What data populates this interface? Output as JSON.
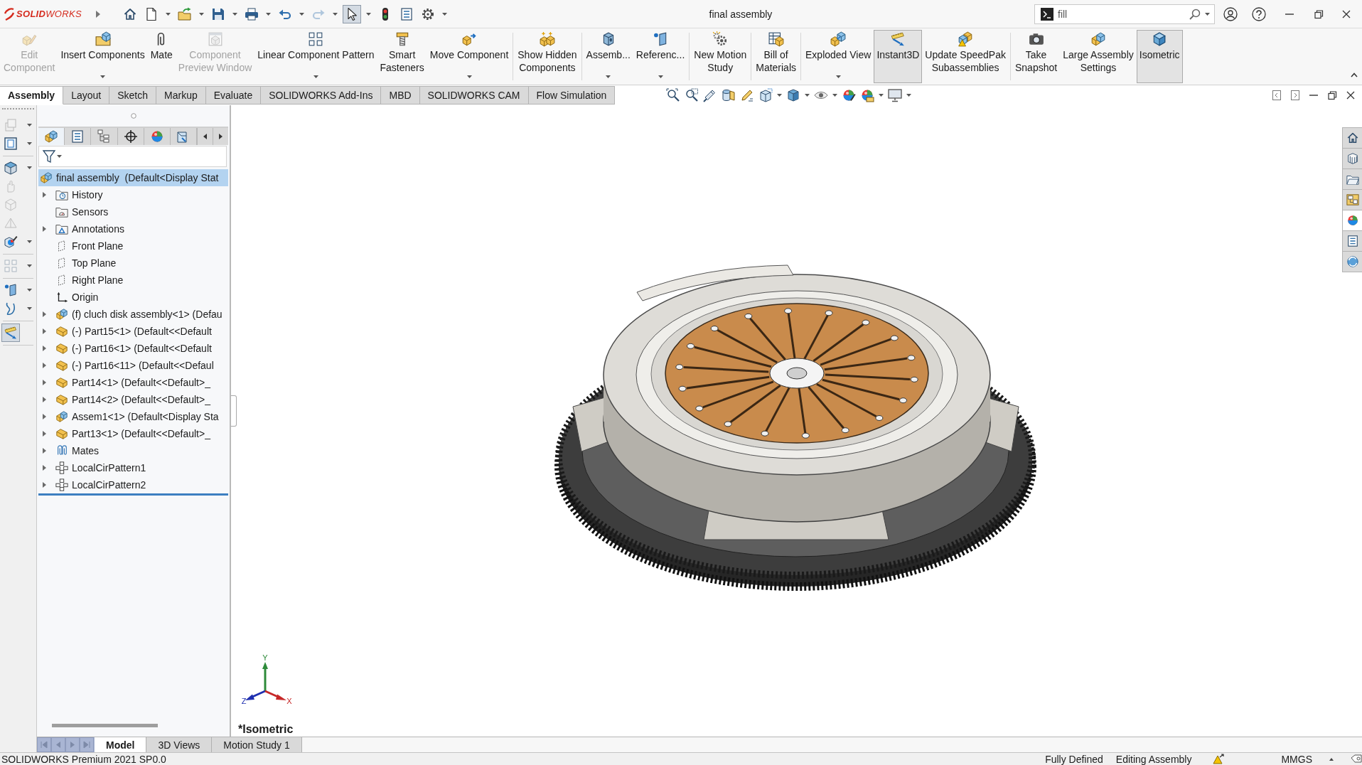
{
  "title_bar": {
    "logo": "**SOLID**WORKS",
    "quick_access": [
      {
        "kind": "home",
        "dropdown": false,
        "disabled": false,
        "pressed": false
      },
      {
        "kind": "new",
        "dropdown": true,
        "disabled": false,
        "pressed": false
      },
      {
        "kind": "open",
        "dropdown": true,
        "disabled": false,
        "pressed": false
      },
      {
        "kind": "save",
        "dropdown": true,
        "disabled": false,
        "pressed": false
      },
      {
        "kind": "print",
        "dropdown": true,
        "disabled": false,
        "pressed": false
      },
      {
        "kind": "undo",
        "dropdown": true,
        "disabled": false,
        "pressed": false
      },
      {
        "kind": "redo",
        "dropdown": true,
        "disabled": true,
        "pressed": false
      },
      {
        "kind": "select",
        "dropdown": true,
        "disabled": false,
        "pressed": true
      },
      {
        "kind": "rebuild",
        "dropdown": false,
        "disabled": false,
        "pressed": false
      },
      {
        "kind": "properties",
        "dropdown": false,
        "disabled": false,
        "pressed": false
      },
      {
        "kind": "options",
        "dropdown": true,
        "disabled": false,
        "pressed": false
      }
    ],
    "title": "final assembly",
    "search": {
      "value": "fill"
    }
  },
  "ribbon": {
    "groups": [
      [
        {
          "kind": "edit-component",
          "lines": [
            "Edit",
            "Component"
          ],
          "disabled": true,
          "dropdown": false,
          "pressed": false
        },
        {
          "kind": "insert-components",
          "lines": [
            "Insert Components"
          ],
          "disabled": false,
          "dropdown": true,
          "pressed": false
        },
        {
          "kind": "mate",
          "lines": [
            "Mate"
          ],
          "disabled": false,
          "dropdown": false,
          "pressed": false
        },
        {
          "kind": "preview-window",
          "lines": [
            "Component",
            "Preview Window"
          ],
          "disabled": true,
          "dropdown": false,
          "pressed": false
        },
        {
          "kind": "linear-pattern",
          "lines": [
            "Linear Component Pattern"
          ],
          "disabled": false,
          "dropdown": true,
          "pressed": false
        },
        {
          "kind": "smart-fasteners",
          "lines": [
            "Smart",
            "Fasteners"
          ],
          "disabled": false,
          "dropdown": false,
          "pressed": false
        },
        {
          "kind": "move-component",
          "lines": [
            "Move Component"
          ],
          "disabled": false,
          "dropdown": true,
          "pressed": false
        }
      ],
      [
        {
          "kind": "show-hidden",
          "lines": [
            "Show Hidden",
            "Components"
          ],
          "disabled": false,
          "dropdown": false,
          "pressed": false
        }
      ],
      [
        {
          "kind": "assembly-features",
          "lines": [
            "Assemb..."
          ],
          "disabled": false,
          "dropdown": true,
          "pressed": false
        },
        {
          "kind": "reference-geometry",
          "lines": [
            "Referenc..."
          ],
          "disabled": false,
          "dropdown": true,
          "pressed": false
        }
      ],
      [
        {
          "kind": "motion-study",
          "lines": [
            "New Motion",
            "Study"
          ],
          "disabled": false,
          "dropdown": false,
          "pressed": false
        }
      ],
      [
        {
          "kind": "bom",
          "lines": [
            "Bill of",
            "Materials"
          ],
          "disabled": false,
          "dropdown": false,
          "pressed": false
        }
      ],
      [
        {
          "kind": "exploded-view",
          "lines": [
            "Exploded View"
          ],
          "disabled": false,
          "dropdown": true,
          "pressed": false
        },
        {
          "kind": "instant3d",
          "lines": [
            "Instant3D"
          ],
          "disabled": false,
          "dropdown": false,
          "pressed": true
        },
        {
          "kind": "speedpak",
          "lines": [
            "Update SpeedPak",
            "Subassemblies"
          ],
          "disabled": false,
          "dropdown": false,
          "pressed": false
        }
      ],
      [
        {
          "kind": "snapshot",
          "lines": [
            "Take",
            "Snapshot"
          ],
          "disabled": false,
          "dropdown": false,
          "pressed": false
        },
        {
          "kind": "large-assembly",
          "lines": [
            "Large Assembly",
            "Settings"
          ],
          "disabled": false,
          "dropdown": false,
          "pressed": false
        },
        {
          "kind": "isometric",
          "lines": [
            "Isometric"
          ],
          "disabled": false,
          "dropdown": false,
          "pressed": true
        }
      ]
    ]
  },
  "command_tabs": [
    {
      "label": "Assembly",
      "selected": true
    },
    {
      "label": "Layout",
      "selected": false
    },
    {
      "label": "Sketch",
      "selected": false
    },
    {
      "label": "Markup",
      "selected": false
    },
    {
      "label": "Evaluate",
      "selected": false
    },
    {
      "label": "SOLIDWORKS Add-Ins",
      "selected": false
    },
    {
      "label": "MBD",
      "selected": false
    },
    {
      "label": "SOLIDWORKS CAM",
      "selected": false
    },
    {
      "label": "Flow Simulation",
      "selected": false
    }
  ],
  "view_toolbar": [
    {
      "kind": "zoom-fit",
      "dropdown": false
    },
    {
      "kind": "zoom-area",
      "dropdown": false
    },
    {
      "kind": "previous-view",
      "dropdown": false
    },
    {
      "kind": "section-view",
      "dropdown": false
    },
    {
      "kind": "annotation-views",
      "dropdown": false
    },
    {
      "kind": "orientation",
      "dropdown": true
    },
    {
      "kind": "display-style",
      "dropdown": true
    },
    {
      "kind": "hide-show",
      "dropdown": true
    },
    {
      "kind": "appearance",
      "dropdown": false
    },
    {
      "kind": "scene",
      "dropdown": true
    },
    {
      "kind": "view-settings",
      "dropdown": true
    }
  ],
  "left_toolbar": [
    [
      {
        "disabled": true,
        "dropdown": true,
        "pressed": false
      },
      {
        "disabled": false,
        "dropdown": true,
        "pressed": false
      }
    ],
    [
      {
        "disabled": false,
        "dropdown": true,
        "pressed": false
      },
      {
        "disabled": true,
        "dropdown": false,
        "pressed": false
      },
      {
        "disabled": true,
        "dropdown": false,
        "pressed": false
      },
      {
        "disabled": true,
        "dropdown": false,
        "pressed": false
      },
      {
        "disabled": false,
        "dropdown": true,
        "pressed": false
      }
    ],
    [
      {
        "disabled": true,
        "dropdown": true,
        "pressed": false
      }
    ],
    [
      {
        "disabled": false,
        "dropdown": true,
        "pressed": false
      },
      {
        "disabled": false,
        "dropdown": true,
        "pressed": false
      }
    ],
    [
      {
        "disabled": false,
        "dropdown": false,
        "pressed": true
      }
    ]
  ],
  "feature_tree": {
    "panel_tabs": [
      {
        "kind": "feature-manager",
        "selected": true
      },
      {
        "kind": "property-manager",
        "selected": false
      },
      {
        "kind": "configuration-manager",
        "selected": false
      },
      {
        "kind": "dimxpert",
        "selected": false
      },
      {
        "kind": "display-manager",
        "selected": false
      },
      {
        "kind": "cam",
        "selected": false
      }
    ],
    "items": [
      {
        "label": "final assembly  (Default<Display Stat",
        "kind": "assembly",
        "selected": true,
        "children": [
          {
            "label": "History",
            "kind": "history",
            "expandable": true,
            "selected": false
          },
          {
            "label": "Sensors",
            "kind": "sensors",
            "expandable": false,
            "selected": false
          },
          {
            "label": "Annotations",
            "kind": "annotations",
            "expandable": true,
            "selected": false
          },
          {
            "label": "Front Plane",
            "kind": "plane",
            "expandable": false,
            "selected": false
          },
          {
            "label": "Top Plane",
            "kind": "plane",
            "expandable": false,
            "selected": false
          },
          {
            "label": "Right Plane",
            "kind": "plane",
            "expandable": false,
            "selected": false
          },
          {
            "label": "Origin",
            "kind": "origin",
            "expandable": false,
            "selected": false
          },
          {
            "label": "(f) cluch disk assembly<1> (Defau",
            "kind": "subassembly",
            "expandable": true,
            "selected": false
          },
          {
            "label": "(-) Part15<1> (Default<<Default",
            "kind": "part",
            "expandable": true,
            "selected": false
          },
          {
            "label": "(-) Part16<1> (Default<<Default",
            "kind": "part",
            "expandable": true,
            "selected": false
          },
          {
            "label": "(-) Part16<11> (Default<<Defaul",
            "kind": "part",
            "expandable": true,
            "selected": false
          },
          {
            "label": "Part14<1> (Default<<Default>_",
            "kind": "part",
            "expandable": true,
            "selected": false
          },
          {
            "label": "Part14<2> (Default<<Default>_",
            "kind": "part",
            "expandable": true,
            "selected": false
          },
          {
            "label": "Assem1<1> (Default<Display Sta",
            "kind": "subassembly",
            "expandable": true,
            "selected": false
          },
          {
            "label": "Part13<1> (Default<<Default>_",
            "kind": "part",
            "expandable": true,
            "selected": false
          },
          {
            "label": "Mates",
            "kind": "mates",
            "expandable": true,
            "selected": false
          },
          {
            "label": "LocalCirPattern1",
            "kind": "pattern",
            "expandable": true,
            "selected": false
          },
          {
            "label": "LocalCirPattern2",
            "kind": "pattern",
            "expandable": true,
            "selected": false
          }
        ]
      }
    ]
  },
  "viewport": {
    "view_label": "*Isometric",
    "triad": [
      {
        "label": "Y",
        "color": "#2e8b3a"
      },
      {
        "label": "Z",
        "color": "#1f2fb0"
      },
      {
        "label": "X",
        "color": "#c62828"
      }
    ],
    "task_pane": [
      {
        "kind": "home",
        "selected": false
      },
      {
        "kind": "content-central",
        "selected": false
      },
      {
        "kind": "file-explorer",
        "selected": false
      },
      {
        "kind": "view-palette",
        "selected": false
      },
      {
        "kind": "appearances",
        "selected": true
      },
      {
        "kind": "custom-properties",
        "selected": false
      },
      {
        "kind": "forum",
        "selected": false
      }
    ]
  },
  "bottom_tabs": [
    {
      "label": "Model",
      "selected": true
    },
    {
      "label": "3D Views",
      "selected": false
    },
    {
      "label": "Motion Study 1",
      "selected": false
    }
  ],
  "status_bar": {
    "version": "SOLIDWORKS Premium 2021 SP0.0",
    "definition": "Fully Defined",
    "mode": "Editing Assembly",
    "units": "MMGS"
  }
}
